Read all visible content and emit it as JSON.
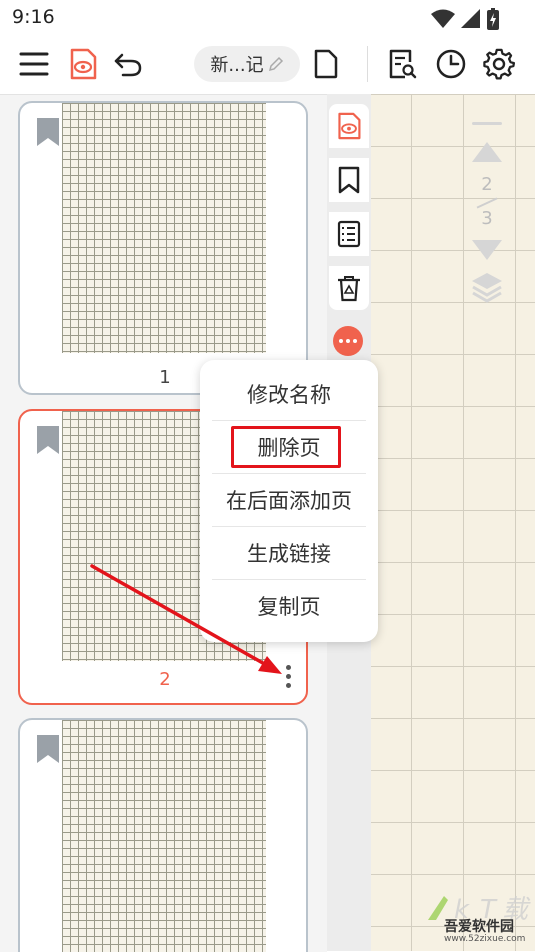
{
  "status_bar": {
    "time": "9:16"
  },
  "toolbar": {
    "note_title": "新...记"
  },
  "thumbnails": [
    {
      "page_number": "1"
    },
    {
      "page_number": "2"
    },
    {
      "page_number": ""
    }
  ],
  "pager": {
    "current": "2",
    "total": "3"
  },
  "context_menu": {
    "items": [
      "修改名称",
      "删除页",
      "在后面添加页",
      "生成链接",
      "复制页"
    ]
  },
  "watermark": {
    "text": "吾爱软件园",
    "url": "www.52zixue.com"
  },
  "colors": {
    "accent": "#f0624d",
    "highlight": "#e3141b",
    "paper": "#f6f3e9"
  }
}
